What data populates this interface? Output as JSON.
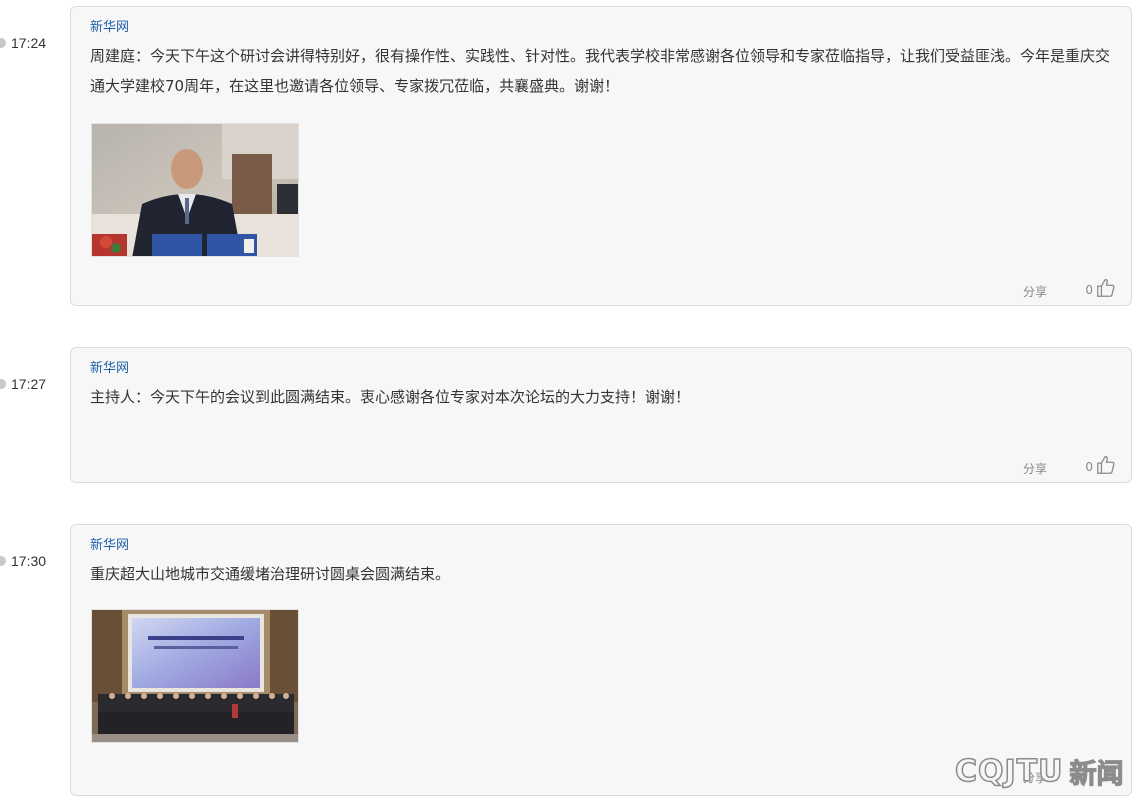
{
  "entries": [
    {
      "time": "17:24",
      "source": "新华网",
      "content": "周建庭：今天下午这个研讨会讲得特别好，很有操作性、实践性、针对性。我代表学校非常感谢各位领导和专家莅临指导，让我们受益匪浅。今年是重庆交通大学建校70周年，在这里也邀请各位领导、专家拨冗莅临，共襄盛典。谢谢！",
      "share_label": "分享",
      "like_count": "0"
    },
    {
      "time": "17:27",
      "source": "新华网",
      "content": "主持人：今天下午的会议到此圆满结束。衷心感谢各位专家对本次论坛的大力支持！谢谢！",
      "share_label": "分享",
      "like_count": "0"
    },
    {
      "time": "17:30",
      "source": "新华网",
      "content": "重庆超大山地城市交通缓堵治理研讨圆桌会圆满结束。",
      "share_label": "分享"
    }
  ],
  "watermark": {
    "latin": "CQJTU",
    "cjk": "新闻"
  },
  "colors": {
    "source_link": "#1f5fa8",
    "card_bg": "#f7f7f7",
    "card_border": "#dcdcdc",
    "meta_text": "#888888"
  }
}
